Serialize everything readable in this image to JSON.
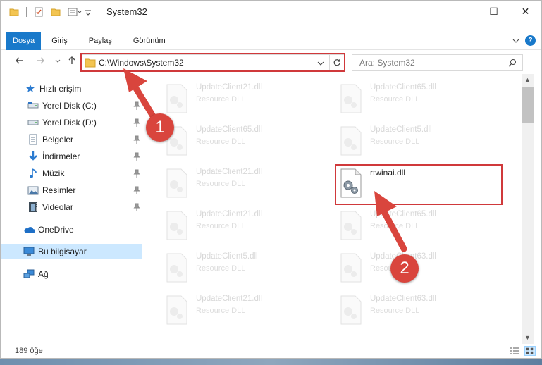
{
  "window": {
    "title": "System32"
  },
  "titlebar": {
    "minimize": "—",
    "maximize": "☐",
    "close": "✕"
  },
  "ribbon": {
    "tabs": [
      "Dosya",
      "Giriş",
      "Paylaş",
      "Görünüm"
    ],
    "help_label": "?"
  },
  "address": {
    "path": "C:\\Windows\\System32",
    "search_placeholder": "Ara: System32"
  },
  "nav": {
    "items": [
      {
        "label": "Hızlı erişim",
        "icon": "star-icon"
      },
      {
        "label": "Yerel Disk (C:)",
        "icon": "drive-icon",
        "pinned": true
      },
      {
        "label": "Yerel Disk (D:)",
        "icon": "drive-icon",
        "pinned": true
      },
      {
        "label": "Belgeler",
        "icon": "documents-icon",
        "pinned": true
      },
      {
        "label": "İndirmeler",
        "icon": "download-icon",
        "pinned": true
      },
      {
        "label": "Müzik",
        "icon": "music-icon",
        "pinned": true
      },
      {
        "label": "Resimler",
        "icon": "pictures-icon",
        "pinned": true
      },
      {
        "label": "Videolar",
        "icon": "videos-icon",
        "pinned": true
      },
      {
        "label": "OneDrive",
        "icon": "onedrive-icon"
      },
      {
        "label": "Bu bilgisayar",
        "icon": "computer-icon",
        "selected": true
      },
      {
        "label": "Ağ",
        "icon": "network-icon"
      }
    ]
  },
  "files": [
    {
      "name": "UpdateClient21.dll",
      "type": "Resource DLL"
    },
    {
      "name": "UpdateClient65.dll",
      "type": "Resource DLL"
    },
    {
      "name": "UpdateClient65.dll",
      "type": "Resource DLL"
    },
    {
      "name": "UpdateClient5.dll",
      "type": "Resource DLL"
    },
    {
      "name": "UpdateClient21.dll",
      "type": "Resource DLL"
    },
    {
      "name": "rtwinai.dll",
      "type": "",
      "highlighted": true
    },
    {
      "name": "UpdateClient21.dll",
      "type": "Resource DLL"
    },
    {
      "name": "UpdateClient65.dll",
      "type": "Resource DLL"
    },
    {
      "name": "UpdateClient5.dll",
      "type": "Resource DLL"
    },
    {
      "name": "UpdateClient63.dll",
      "type": "Resource DLL"
    },
    {
      "name": "UpdateClient21.dll",
      "type": "Resource DLL"
    },
    {
      "name": "UpdateClient63.dll",
      "type": "Resource DLL"
    }
  ],
  "callouts": {
    "step1": "1",
    "step2": "2"
  },
  "status": {
    "count": "189 öğe"
  },
  "colors": {
    "accent": "#1979ca",
    "highlight": "#d0393b",
    "selection": "#cce8ff"
  }
}
